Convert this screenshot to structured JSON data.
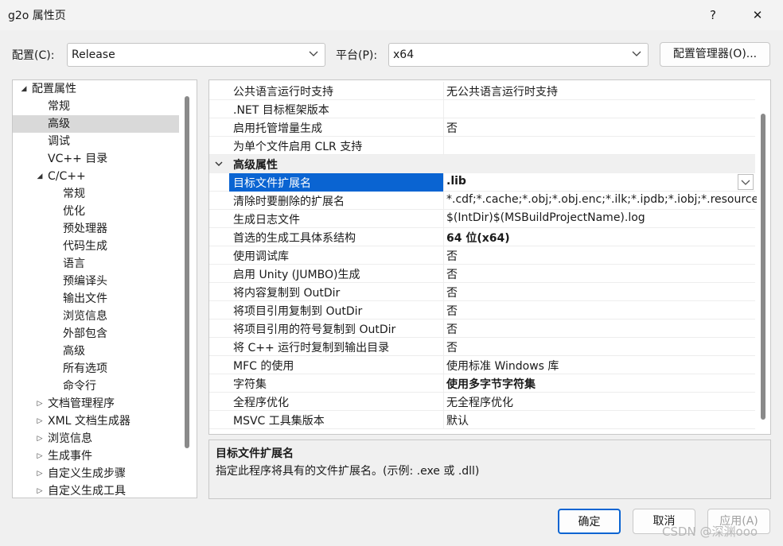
{
  "window": {
    "title": "g2o 属性页",
    "help_label": "?",
    "close_label": "✕"
  },
  "toolbar": {
    "config_label": "配置(C):",
    "config_value": "Release",
    "platform_label": "平台(P):",
    "platform_value": "x64",
    "config_manager_label": "配置管理器(O)..."
  },
  "tree": {
    "items": [
      {
        "label": "配置属性",
        "toggle": "◢"
      },
      {
        "label": "常规",
        "toggle": ""
      },
      {
        "label": "高级",
        "toggle": "",
        "selected": true
      },
      {
        "label": "调试",
        "toggle": ""
      },
      {
        "label": "VC++ 目录",
        "toggle": ""
      },
      {
        "label": "C/C++",
        "toggle": "◢"
      },
      {
        "label": "常规",
        "toggle": ""
      },
      {
        "label": "优化",
        "toggle": ""
      },
      {
        "label": "预处理器",
        "toggle": ""
      },
      {
        "label": "代码生成",
        "toggle": ""
      },
      {
        "label": "语言",
        "toggle": ""
      },
      {
        "label": "预编译头",
        "toggle": ""
      },
      {
        "label": "输出文件",
        "toggle": ""
      },
      {
        "label": "浏览信息",
        "toggle": ""
      },
      {
        "label": "外部包含",
        "toggle": ""
      },
      {
        "label": "高级",
        "toggle": ""
      },
      {
        "label": "所有选项",
        "toggle": ""
      },
      {
        "label": "命令行",
        "toggle": ""
      },
      {
        "label": "文档管理程序",
        "toggle": "▷"
      },
      {
        "label": "XML 文档生成器",
        "toggle": "▷"
      },
      {
        "label": "浏览信息",
        "toggle": "▷"
      },
      {
        "label": "生成事件",
        "toggle": "▷"
      },
      {
        "label": "自定义生成步骤",
        "toggle": "▷"
      },
      {
        "label": "自定义生成工具",
        "toggle": "▷"
      }
    ]
  },
  "grid": {
    "rows": [
      {
        "type": "prop",
        "name": "公共语言运行时支持",
        "value": "无公共语言运行时支持"
      },
      {
        "type": "prop",
        "name": ".NET 目标框架版本",
        "value": ""
      },
      {
        "type": "prop",
        "name": "启用托管增量生成",
        "value": "否"
      },
      {
        "type": "prop",
        "name": "为单个文件启用 CLR 支持",
        "value": ""
      },
      {
        "type": "category",
        "name": "高级属性"
      },
      {
        "type": "prop",
        "name": "目标文件扩展名",
        "value": ".lib",
        "bold": true,
        "selected": true
      },
      {
        "type": "prop",
        "name": "清除时要删除的扩展名",
        "value": "*.cdf;*.cache;*.obj;*.obj.enc;*.ilk;*.ipdb;*.iobj;*.resource"
      },
      {
        "type": "prop",
        "name": "生成日志文件",
        "value": "$(IntDir)$(MSBuildProjectName).log"
      },
      {
        "type": "prop",
        "name": "首选的生成工具体系结构",
        "value": "64 位(x64)",
        "bold": true
      },
      {
        "type": "prop",
        "name": "使用调试库",
        "value": "否"
      },
      {
        "type": "prop",
        "name": "启用 Unity (JUMBO)生成",
        "value": "否"
      },
      {
        "type": "prop",
        "name": "将内容复制到 OutDir",
        "value": "否"
      },
      {
        "type": "prop",
        "name": "将项目引用复制到 OutDir",
        "value": "否"
      },
      {
        "type": "prop",
        "name": "将项目引用的符号复制到 OutDir",
        "value": "否"
      },
      {
        "type": "prop",
        "name": "将 C++ 运行时复制到输出目录",
        "value": "否"
      },
      {
        "type": "prop",
        "name": "MFC 的使用",
        "value": "使用标准 Windows 库"
      },
      {
        "type": "prop",
        "name": "字符集",
        "value": "使用多字节字符集",
        "bold": true
      },
      {
        "type": "prop",
        "name": "全程序优化",
        "value": "无全程序优化"
      },
      {
        "type": "prop",
        "name": "MSVC 工具集版本",
        "value": "默认"
      }
    ]
  },
  "description": {
    "title": "目标文件扩展名",
    "text": "指定此程序将具有的文件扩展名。(示例: .exe 或 .dll)"
  },
  "footer": {
    "ok_label": "确定",
    "cancel_label": "取消",
    "apply_label": "应用(A)"
  },
  "watermark": "CSDN @深渊ooo",
  "colors": {
    "selection": "#0a64d2",
    "tree_selection": "#d9d9d9"
  }
}
